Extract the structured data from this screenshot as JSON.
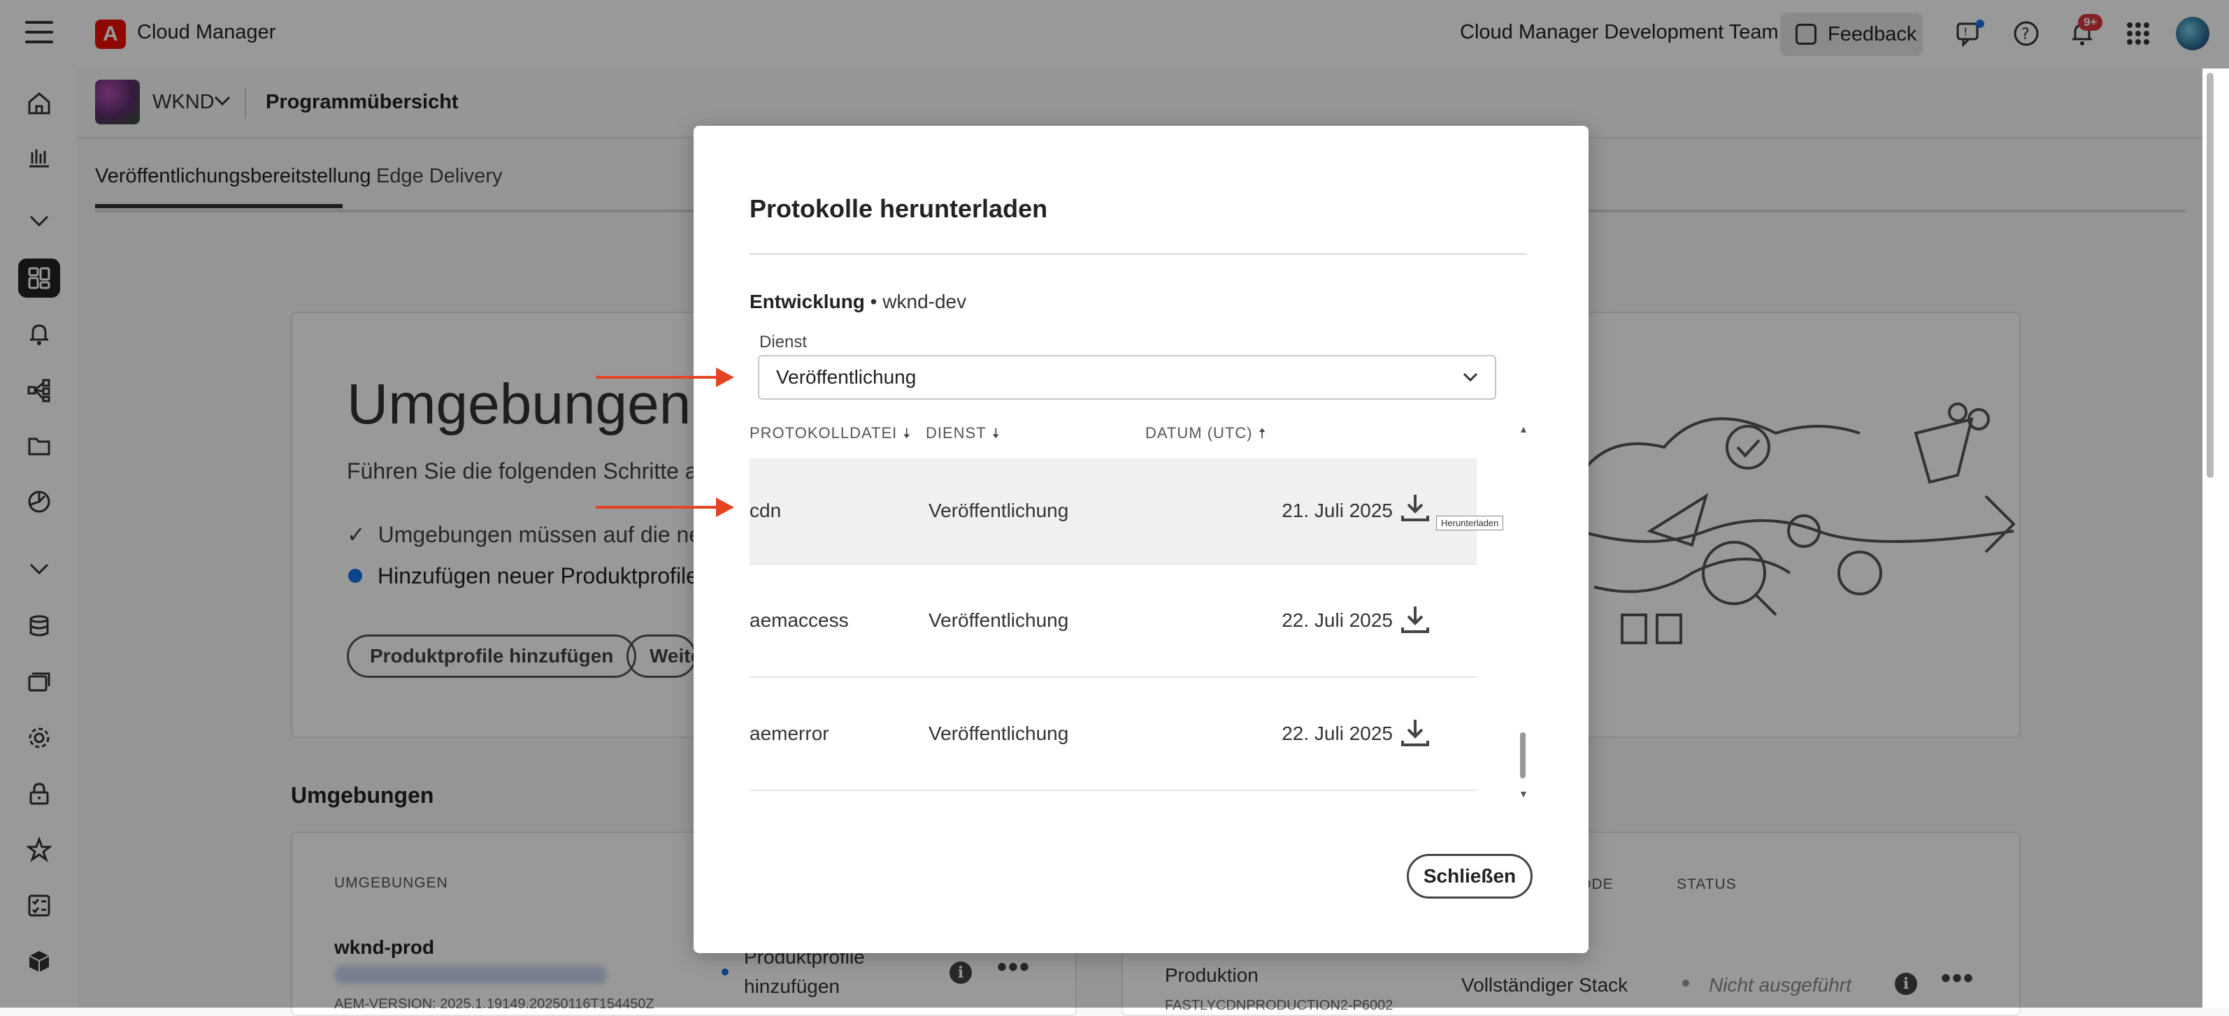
{
  "topbar": {
    "app_name": "Cloud Manager",
    "adobe_letter": "A",
    "team_name": "Cloud Manager Development Team",
    "feedback_label": "Feedback",
    "notification_badge": "9+"
  },
  "program": {
    "name": "WKND",
    "overview_title": "Programmübersicht"
  },
  "tabs": [
    {
      "label": "Veröffentlichungsbereitstellung",
      "active": true
    },
    {
      "label": "Edge Delivery",
      "active": false
    }
  ],
  "background": {
    "hero_title": "Umgebungen m",
    "hero_sub": "Führen Sie die folgenden Schritte aus,",
    "check_item": "Umgebungen müssen auf die neue",
    "bullet_item": "Hinzufügen neuer Produktprofile zu",
    "btn_add_profiles": "Produktprofile hinzufügen",
    "btn_more": "Weite",
    "section_title": "Umgebungen",
    "col_env": "UMGEBUNGEN",
    "col_code": "R CODE",
    "col_status": "STATUS",
    "env_name": "wknd-prod",
    "aem_version": "AEM-VERSION: 2025.1.19149.20250116T154450Z",
    "add_profiles_line1": "Produktprofile",
    "add_profiles_line2": "hinzufügen",
    "production": "Produktion",
    "fastly": "FASTLYCDNPRODUCTION2-P6002",
    "full_stack": "Vollständiger Stack",
    "not_executed": "Nicht ausgeführt"
  },
  "dialog": {
    "title": "Protokolle herunterladen",
    "env_label": "Entwicklung",
    "env_separator": " • ",
    "env_value": "wknd-dev",
    "service_label": "Dienst",
    "service_value": "Veröffentlichung",
    "columns": {
      "file": "PROTOKOLLDATEI",
      "service": "DIENST",
      "date": "DATUM (UTC)"
    },
    "rows": [
      {
        "file": "cdn",
        "service": "Veröffentlichung",
        "date": "21. Juli 2025"
      },
      {
        "file": "aemaccess",
        "service": "Veröffentlichung",
        "date": "22. Juli 2025"
      },
      {
        "file": "aemerror",
        "service": "Veröffentlichung",
        "date": "22. Juli 2025"
      }
    ],
    "download_tooltip": "Herunterladen",
    "close_label": "Schließen"
  },
  "colors": {
    "accent_blue": "#1473e6",
    "adobe_red": "#eb1000",
    "annotation_arrow": "#e34524",
    "badge_red": "#d7373f"
  }
}
